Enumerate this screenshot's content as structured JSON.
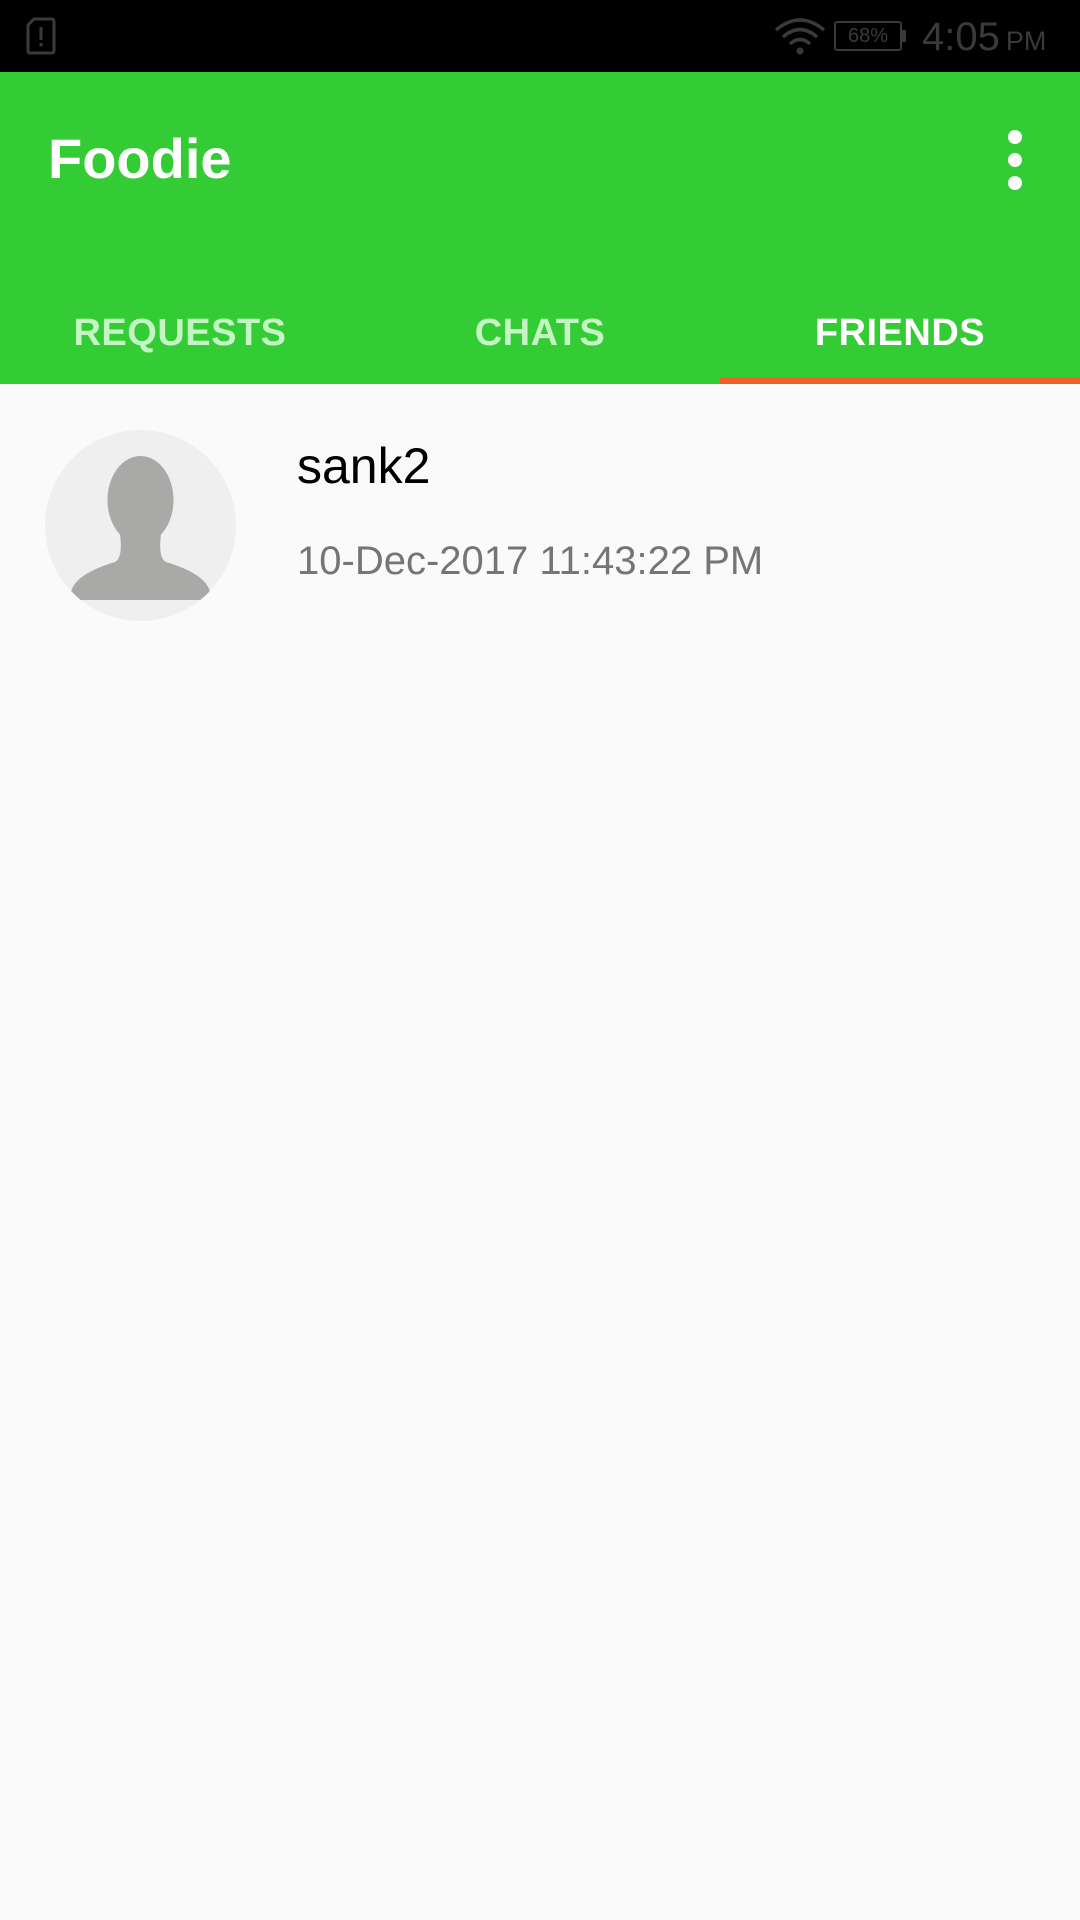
{
  "status_bar": {
    "battery": "68%",
    "time": "4:05",
    "ampm": "PM"
  },
  "app": {
    "title": "Foodie",
    "brand_color": "#34cc34",
    "accent_color": "#f0602a"
  },
  "tabs": [
    {
      "label": "REQUESTS",
      "active": false
    },
    {
      "label": "CHATS",
      "active": false
    },
    {
      "label": "FRIENDS",
      "active": true
    }
  ],
  "friends": [
    {
      "name": "sank2",
      "date": "10-Dec-2017 11:43:22 PM"
    }
  ]
}
